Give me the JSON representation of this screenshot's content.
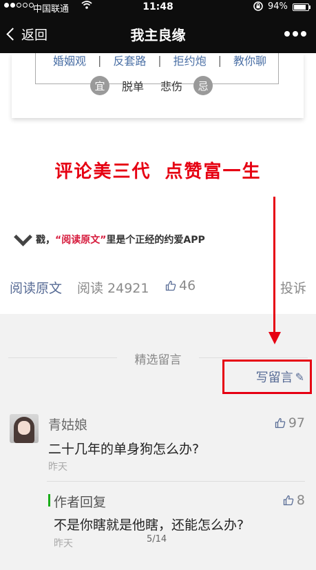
{
  "status_bar": {
    "carrier": "中国联通",
    "time": "11:48",
    "battery": "94%"
  },
  "nav": {
    "back_label": "返回",
    "title": "我主良缘",
    "more_label": "•••"
  },
  "article_card": {
    "tags": [
      "婚姻观",
      "反套路",
      "拒约炮",
      "教你聊"
    ],
    "suitable_mark": "宜",
    "suitable_text": "脱单",
    "avoid_text": "悲伤",
    "avoid_mark": "忌"
  },
  "slogan": {
    "part1": "评论美三代",
    "part2": "点赞富一生"
  },
  "invite": {
    "prefix": "戳，",
    "quote": "“阅读原文”",
    "suffix": "里是个正经的约爱APP"
  },
  "stats": {
    "read_original": "阅读原文",
    "reads": "阅读 24921",
    "likes": "46",
    "report": "投诉"
  },
  "comments": {
    "section_title": "精选留言",
    "write_label": "写留言",
    "items": [
      {
        "user": "青姑娘",
        "likes": "97",
        "text": "二十几年的单身狗怎么办?",
        "time": "昨天",
        "reply": {
          "label": "作者回复",
          "likes": "8",
          "text": "不是你瞎就是他瞎，还能怎么办?",
          "time": "昨天"
        }
      }
    ]
  },
  "page_indicator": "5/14",
  "colors": {
    "accent_red": "#e60012",
    "link_blue": "#576b95",
    "reply_green": "#1aad19",
    "nav_bg": "#0d0d0d"
  }
}
